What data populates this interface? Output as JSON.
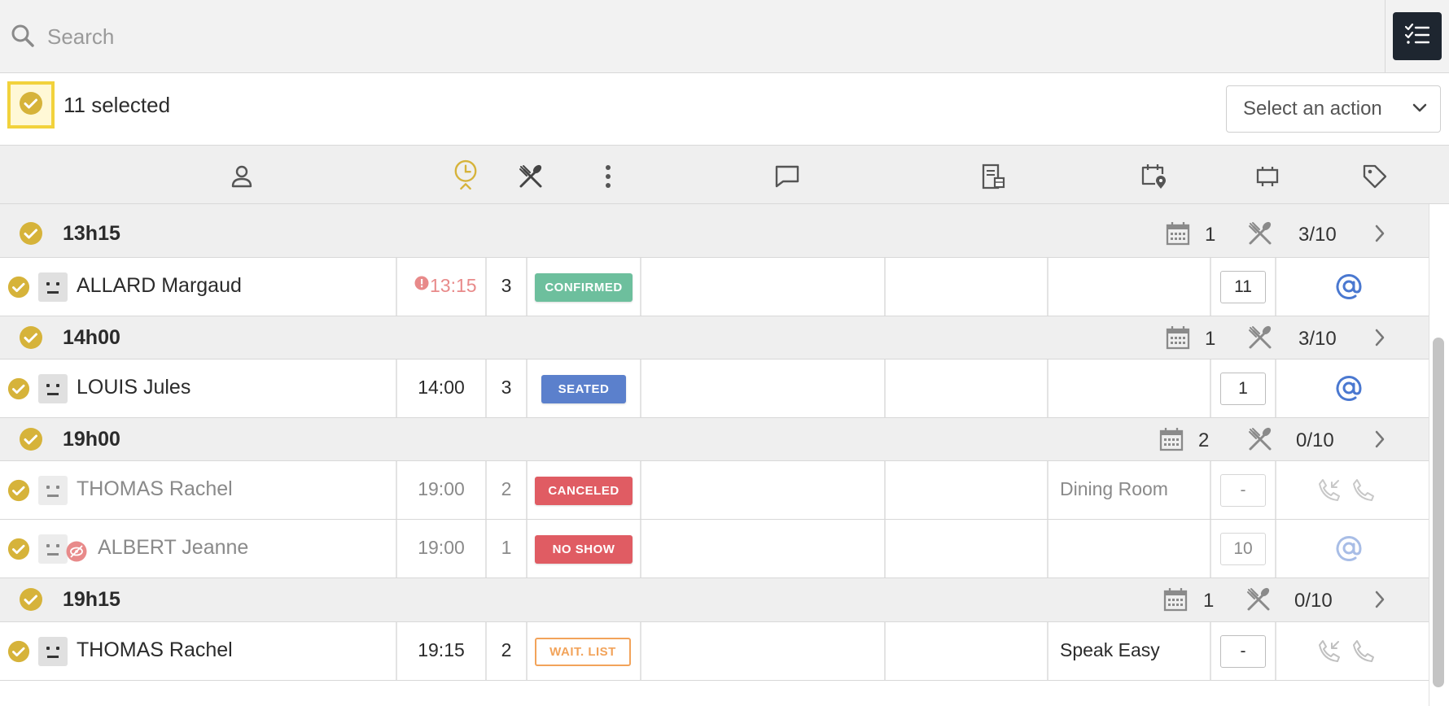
{
  "search": {
    "placeholder": "Search"
  },
  "selection": {
    "count_label": "11 selected",
    "action_select_label": "Select an action"
  },
  "colors": {
    "accent_gold": "#d6b33a",
    "confirmed": "#6dbf9d",
    "seated": "#5b80cc",
    "canceled": "#e05c63",
    "no_show": "#e05c63",
    "wait_list": "#f2a35a",
    "dark_button": "#1e2630"
  },
  "columns": [
    {
      "icon": "person-icon"
    },
    {
      "icon": "clock-icon"
    },
    {
      "icon": "utensils-icon"
    },
    {
      "icon": "vertical-dots-icon"
    },
    {
      "icon": "comment-icon"
    },
    {
      "icon": "notes-icon"
    },
    {
      "icon": "calendar-location-icon"
    },
    {
      "icon": "table-icon"
    },
    {
      "icon": "tag-icon"
    }
  ],
  "groups": [
    {
      "time": "13h15",
      "bookings": "1",
      "covers": "3/10",
      "reservations": [
        {
          "name": "ALLARD Margaud",
          "time": "13:15",
          "time_warning": true,
          "guests": "3",
          "status": "CONFIRMED",
          "room": "",
          "table": "11",
          "contact": "email-icon"
        }
      ]
    },
    {
      "time": "14h00",
      "bookings": "1",
      "covers": "3/10",
      "reservations": [
        {
          "name": "LOUIS Jules",
          "time": "14:00",
          "guests": "3",
          "status": "SEATED",
          "room": "",
          "table": "1",
          "contact": "email-icon"
        }
      ]
    },
    {
      "time": "19h00",
      "bookings": "2",
      "covers": "0/10",
      "reservations": [
        {
          "name": "THOMAS Rachel",
          "time": "19:00",
          "guests": "2",
          "status": "CANCELED",
          "room": "Dining Room",
          "table": "-",
          "contact": "phone-icons",
          "faded": true
        },
        {
          "name": "ALBERT Jeanne",
          "time": "19:00",
          "guests": "1",
          "status": "NO SHOW",
          "room": "",
          "table": "10",
          "contact": "email-icon",
          "faded": true,
          "hidden_profile": true
        }
      ]
    },
    {
      "time": "19h15",
      "bookings": "1",
      "covers": "0/10",
      "reservations": [
        {
          "name": "THOMAS Rachel",
          "time": "19:15",
          "guests": "2",
          "status": "WAIT. LIST",
          "room": "Speak Easy",
          "table": "-",
          "contact": "phone-icons"
        }
      ]
    }
  ]
}
